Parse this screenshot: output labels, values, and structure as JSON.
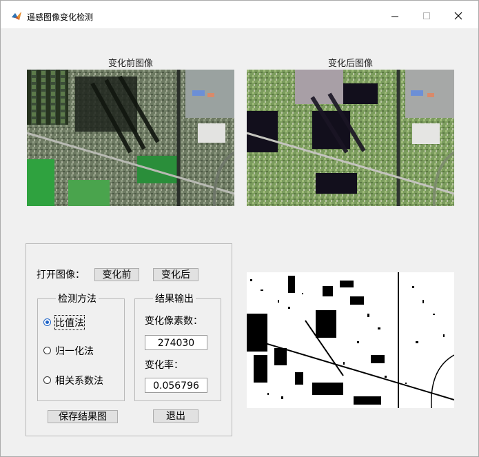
{
  "window": {
    "title": "遥感图像变化检测",
    "app_icon": "matlab-icon"
  },
  "images": {
    "before_title": "变化前图像",
    "after_title": "变化后图像"
  },
  "controls": {
    "open_label": "打开图像：",
    "before_button": "变化前",
    "after_button": "变化后",
    "method_group": {
      "title": "检测方法",
      "options": [
        "比值法",
        "归一化法",
        "相关系数法"
      ],
      "selected": "比值法"
    },
    "result_group": {
      "title": "结果输出",
      "pixel_label": "变化像素数：",
      "pixel_value": "274030",
      "rate_label": "变化率：",
      "rate_value": "0.056796"
    },
    "save_button": "保存结果图",
    "exit_button": "退出"
  }
}
